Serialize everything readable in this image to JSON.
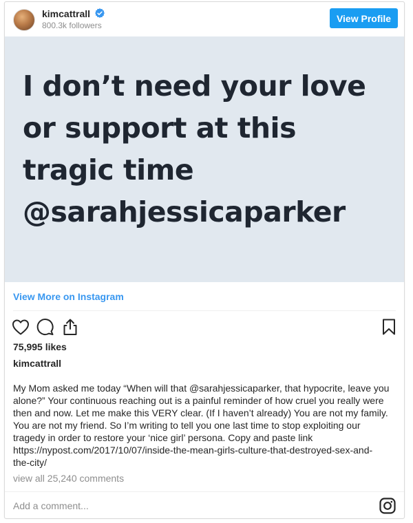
{
  "header": {
    "username": "kimcattrall",
    "followers": "800.3k followers",
    "view_profile_label": "View Profile"
  },
  "post": {
    "quote_text": "I don’t need your love\nor support at this\ntragic time\n@sarahjessicaparker",
    "view_more_label": "View More on Instagram"
  },
  "engagement": {
    "likes": "75,995 likes"
  },
  "caption": {
    "username": "kimcattrall",
    "lines": [
      "My Mom asked me today “When will that @sarahjessicaparker, that hypocrite, leave you",
      "alone?” Your continuous reaching out is a painful reminder of how cruel you really were",
      "then and now. Let me make this VERY clear. (If I haven’t already) You are not my family.",
      "You are not my friend. So I’m writing to tell you one last time to stop exploiting our",
      "tragedy in order to restore your ‘nice girl’ persona. Copy and paste link",
      "https://nypost.com/2017/10/07/inside-the-mean-girls-culture-that-destroyed-sex-and-",
      "the-city/"
    ]
  },
  "comments": {
    "view_all_label": "view all 25,240 comments",
    "add_comment_placeholder": "Add a comment..."
  },
  "icons": {
    "verified": "verified-badge-icon",
    "like": "heart-icon",
    "comment": "comment-bubble-icon",
    "share": "share-icon",
    "save": "bookmark-icon",
    "instagram": "instagram-logo-icon"
  },
  "colors": {
    "accent": "#3897f0",
    "button": "#1a9df2",
    "image_background": "#e1e8ef",
    "quote_text": "#1f2631"
  }
}
